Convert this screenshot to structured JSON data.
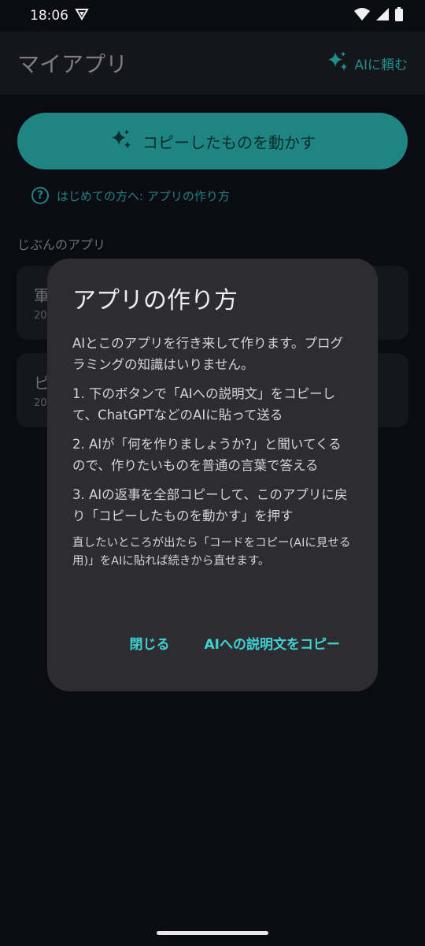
{
  "status_bar": {
    "time": "18:06"
  },
  "app_bar": {
    "title": "マイアプリ",
    "ask_ai_label": "AIに頼む"
  },
  "main_button": {
    "label": "コピーしたものを動かす"
  },
  "help_link": {
    "label": "はじめての方へ: アプリの作り方"
  },
  "section": {
    "label": "じぶんのアプリ"
  },
  "cards": [
    {
      "title": "軍",
      "subtitle": "20"
    },
    {
      "title": "ピ",
      "subtitle": "20"
    }
  ],
  "dialog": {
    "title": "アプリの作り方",
    "intro": "AIとこのアプリを行き来して作ります。プログラミングの知識はいりません。",
    "step1": "1. 下のボタンで「AIへの説明文」をコピーして、ChatGPTなどのAIに貼って送る",
    "step2": "2. AIが「何を作りましょうか?」と聞いてくるので、作りたいものを普通の言葉で答える",
    "step3": "3. AIの返事を全部コピーして、このアプリに戻り「コピーしたものを動かす」を押す",
    "note": "直したいところが出たら「コードをコピー(AIに見せる用)」をAIに貼れば続きから直せます。",
    "close_label": "閉じる",
    "copy_label": "AIへの説明文をコピー"
  },
  "colors": {
    "accent": "#1e8583",
    "dialog_bg": "#2c2c31",
    "action_text": "#3fd2d4"
  }
}
